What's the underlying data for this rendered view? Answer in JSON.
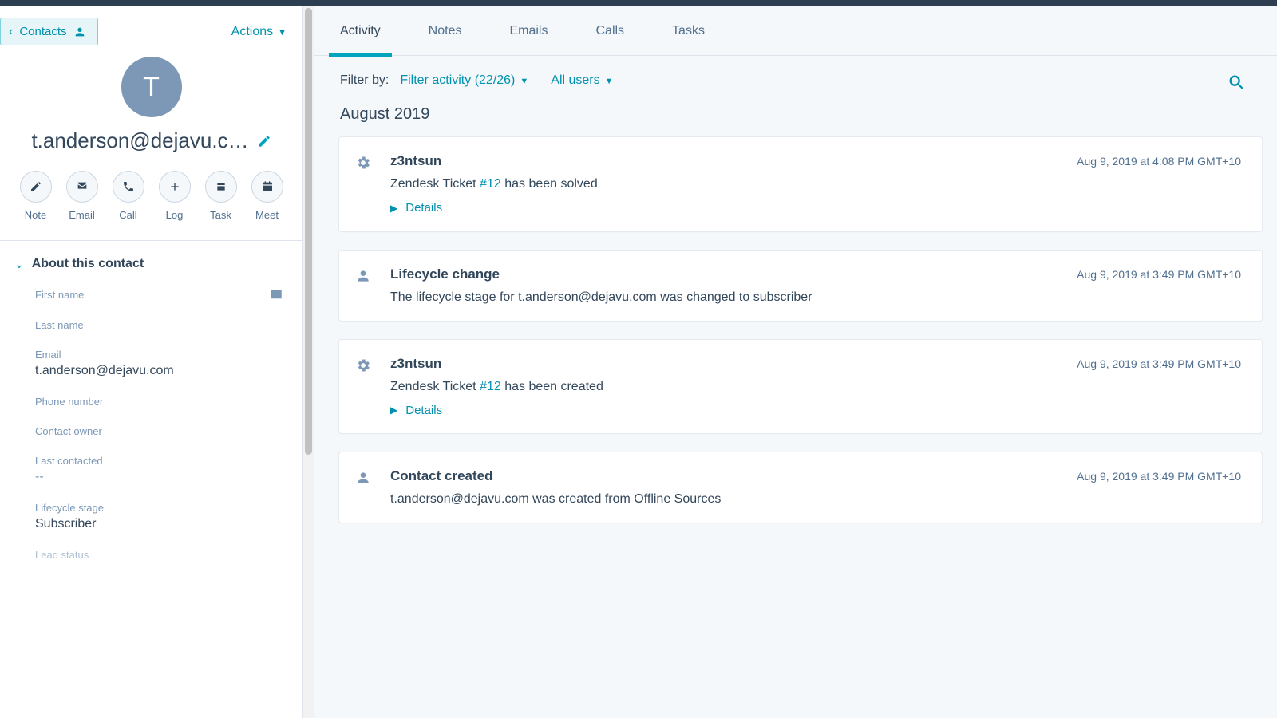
{
  "sidebar": {
    "back_label": "Contacts",
    "actions_label": "Actions",
    "avatar_letter": "T",
    "contact_name_truncated": "t.anderson@dejavu.c…",
    "action_buttons": [
      {
        "id": "note",
        "label": "Note"
      },
      {
        "id": "email",
        "label": "Email"
      },
      {
        "id": "call",
        "label": "Call"
      },
      {
        "id": "log",
        "label": "Log"
      },
      {
        "id": "task",
        "label": "Task"
      },
      {
        "id": "meet",
        "label": "Meet"
      }
    ],
    "about_title": "About this contact",
    "fields": {
      "first_name": {
        "label": "First name",
        "value": ""
      },
      "last_name": {
        "label": "Last name",
        "value": ""
      },
      "email": {
        "label": "Email",
        "value": "t.anderson@dejavu.com"
      },
      "phone": {
        "label": "Phone number",
        "value": ""
      },
      "owner": {
        "label": "Contact owner",
        "value": ""
      },
      "last_contacted": {
        "label": "Last contacted",
        "value": "--"
      },
      "lifecycle": {
        "label": "Lifecycle stage",
        "value": "Subscriber"
      },
      "lead_status": {
        "label": "Lead status",
        "value": ""
      }
    }
  },
  "main": {
    "tabs": [
      {
        "id": "activity",
        "label": "Activity",
        "active": true
      },
      {
        "id": "notes",
        "label": "Notes",
        "active": false
      },
      {
        "id": "emails",
        "label": "Emails",
        "active": false
      },
      {
        "id": "calls",
        "label": "Calls",
        "active": false
      },
      {
        "id": "tasks",
        "label": "Tasks",
        "active": false
      }
    ],
    "filter_label": "Filter by:",
    "filter_activity": "Filter activity (22/26)",
    "filter_users": "All users",
    "month_heading": "August 2019",
    "details_label": "Details",
    "feed": [
      {
        "icon": "gear",
        "title": "z3ntsun",
        "time": "Aug 9, 2019 at 4:08 PM GMT+10",
        "desc_prefix": "Zendesk Ticket ",
        "ticket": "#12",
        "desc_suffix": " has been solved",
        "has_details": true
      },
      {
        "icon": "person",
        "title": "Lifecycle change",
        "time": "Aug 9, 2019 at 3:49 PM GMT+10",
        "desc": "The lifecycle stage for t.anderson@dejavu.com was changed to subscriber",
        "has_details": false
      },
      {
        "icon": "gear",
        "title": "z3ntsun",
        "time": "Aug 9, 2019 at 3:49 PM GMT+10",
        "desc_prefix": "Zendesk Ticket ",
        "ticket": "#12",
        "desc_suffix": " has been created",
        "has_details": true
      },
      {
        "icon": "person",
        "title": "Contact created",
        "time": "Aug 9, 2019 at 3:49 PM GMT+10",
        "desc": "t.anderson@dejavu.com was created from Offline Sources",
        "has_details": false
      }
    ]
  }
}
